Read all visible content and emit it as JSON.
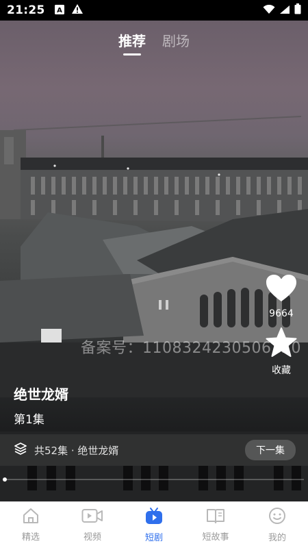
{
  "status_bar": {
    "time": "21:25",
    "left_icons": [
      "font-a-icon",
      "warning-icon"
    ],
    "right_icons": [
      "wifi-icon",
      "signal-icon",
      "battery-icon"
    ]
  },
  "top_tabs": [
    {
      "label": "推荐",
      "active": true
    },
    {
      "label": "剧场",
      "active": false
    }
  ],
  "actions": {
    "like": {
      "icon": "heart-icon",
      "count": "9664"
    },
    "collect": {
      "icon": "star-icon",
      "label": "收藏"
    }
  },
  "watermark": "备案号：1108324230506120",
  "video_info": {
    "title": "绝世龙婿",
    "episode": "第1集",
    "series_summary": "共52集 · 绝世龙婿",
    "next_label": "下一集"
  },
  "progress": {
    "fraction": 0.0
  },
  "bottom_nav": [
    {
      "label": "精选",
      "icon": "home-icon",
      "active": false
    },
    {
      "label": "视频",
      "icon": "video-icon",
      "active": false
    },
    {
      "label": "短剧",
      "icon": "tv-play-icon",
      "active": true
    },
    {
      "label": "短故事",
      "icon": "book-icon",
      "active": false
    },
    {
      "label": "我的",
      "icon": "smiley-face-icon",
      "active": false
    }
  ],
  "colors": {
    "accent": "#2f6fec",
    "nav_inactive": "#9a9a9a"
  }
}
